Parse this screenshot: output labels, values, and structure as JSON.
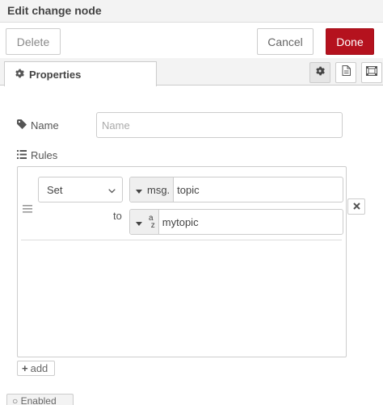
{
  "dialog": {
    "title": "Edit change node",
    "delete_label": "Delete",
    "cancel_label": "Cancel",
    "done_label": "Done",
    "done_color": "#b5121e"
  },
  "tabs": {
    "properties_label": "Properties",
    "properties_icon": "gear-icon",
    "buttons": [
      {
        "icon": "gear-icon",
        "active": true
      },
      {
        "icon": "document-icon",
        "active": false
      },
      {
        "icon": "appearance-icon",
        "active": false
      }
    ]
  },
  "form": {
    "name_label": "Name",
    "name_icon": "tag-icon",
    "name_placeholder": "Name",
    "name_value": "",
    "rules_label": "Rules",
    "rules_icon": "list-icon"
  },
  "rules": [
    {
      "action": "Set",
      "property_type": "msg.",
      "property": "topic",
      "to_label": "to",
      "value_type_icon": "string-type-icon",
      "value_type_glyph_top": "a",
      "value_type_glyph_bottom": "z",
      "value": "mytopic"
    }
  ],
  "add_label": "add",
  "footer": {
    "partial_label": "Enabled"
  }
}
